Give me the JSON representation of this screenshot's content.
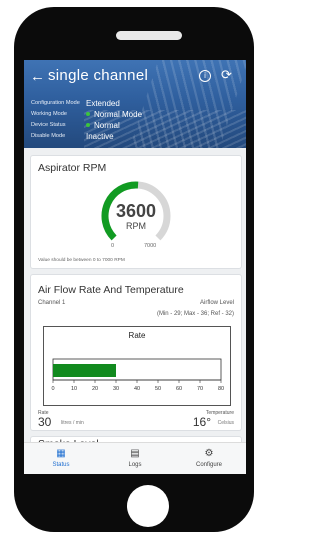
{
  "header": {
    "back_icon": "arrow-left-icon",
    "title": "single channel",
    "info_icon": "info-icon",
    "refresh_icon": "refresh-icon"
  },
  "modes": [
    {
      "label": "Configuration Mode",
      "value": "Extended",
      "dot": false
    },
    {
      "label": "Working Mode",
      "value": "Normal Mode",
      "dot": true
    },
    {
      "label": "Device Status",
      "value": "Normal",
      "dot": true
    },
    {
      "label": "Disable Mode",
      "value": "Inactive",
      "dot": false
    }
  ],
  "aspirator": {
    "title": "Aspirator RPM",
    "value": "3600",
    "unit": "RPM",
    "min": "0",
    "max": "7000",
    "fill_fraction": 0.514,
    "hint": "Value should be between 0 to 7000 RPM"
  },
  "airflow": {
    "title": "Air Flow Rate And Temperature",
    "channel": "Channel 1",
    "level_label": "Airflow Level",
    "limits": "(Min - 29; Max - 36; Ref - 32)",
    "chart_title": "Rate",
    "rate_label": "Rate",
    "rate_value": "30",
    "rate_unit": "litres / min",
    "temp_label": "Temperature",
    "temp_value": "16°",
    "temp_unit": "Celsius"
  },
  "chart_data": {
    "type": "bar",
    "title": "Rate",
    "categories": [
      "Rate"
    ],
    "values": [
      30
    ],
    "xlim": [
      0,
      80
    ],
    "ticks": [
      "0",
      "10",
      "20",
      "30",
      "40",
      "50",
      "60",
      "70",
      "80"
    ],
    "bar_color": "#118a1e",
    "grid": false
  },
  "smoke": {
    "title": "Smoke Level"
  },
  "tabs": [
    {
      "label": "Status",
      "icon": "grid-icon",
      "active": true
    },
    {
      "label": "Logs",
      "icon": "clipboard-icon",
      "active": false
    },
    {
      "label": "Configure",
      "icon": "gear-icon",
      "active": false
    }
  ],
  "colors": {
    "accent": "#1f6fd1",
    "gauge_fill": "#119b22",
    "gauge_track": "#d7d7d7",
    "status_dot": "#3cc43c"
  }
}
